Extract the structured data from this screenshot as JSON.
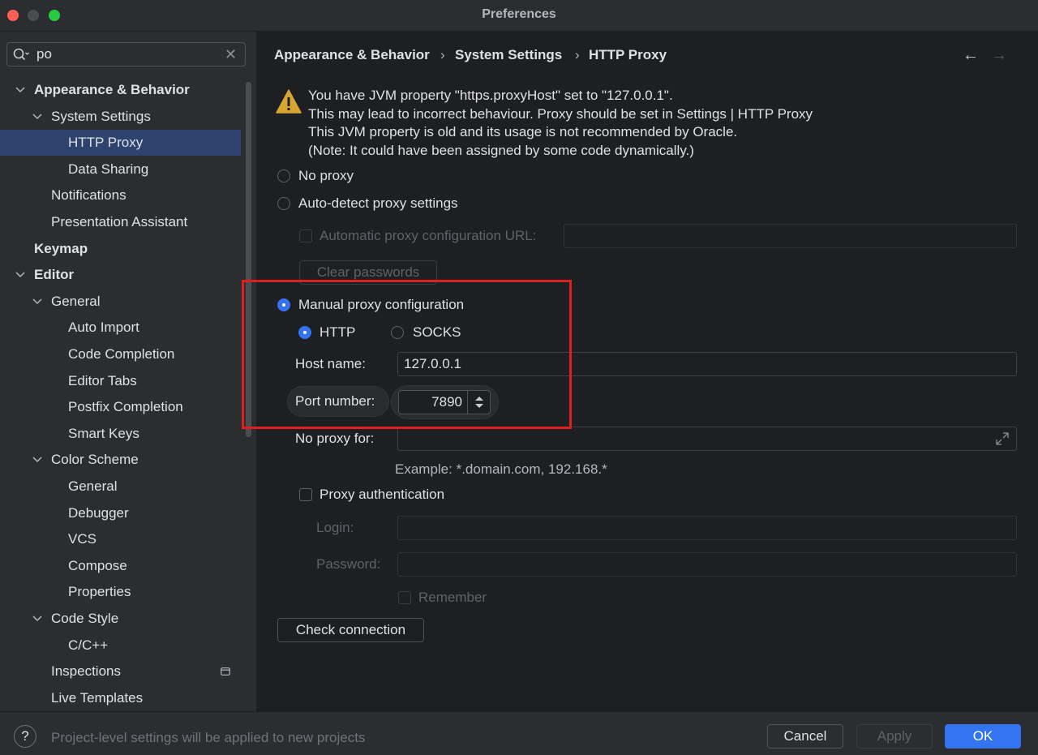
{
  "window": {
    "title": "Preferences"
  },
  "search": {
    "value": "po",
    "clear_glyph": "✕"
  },
  "sidebar": {
    "items": [
      {
        "label": "Appearance & Behavior",
        "bold": true,
        "expanded": true
      },
      {
        "label": "System Settings",
        "expanded": true
      },
      {
        "label": "HTTP Proxy",
        "selected": true
      },
      {
        "label": "Data Sharing"
      },
      {
        "label": "Notifications"
      },
      {
        "label": "Presentation Assistant"
      },
      {
        "label": "Keymap",
        "bold": true
      },
      {
        "label": "Editor",
        "bold": true,
        "expanded": true
      },
      {
        "label": "General",
        "expanded": true
      },
      {
        "label": "Auto Import"
      },
      {
        "label": "Code Completion"
      },
      {
        "label": "Editor Tabs"
      },
      {
        "label": "Postfix Completion"
      },
      {
        "label": "Smart Keys"
      },
      {
        "label": "Color Scheme",
        "expanded": true
      },
      {
        "label": "General"
      },
      {
        "label": "Debugger"
      },
      {
        "label": "VCS"
      },
      {
        "label": "Compose"
      },
      {
        "label": "Properties"
      },
      {
        "label": "Code Style",
        "expanded": true
      },
      {
        "label": "C/C++"
      },
      {
        "label": "Inspections",
        "badge": "project-scope-icon"
      },
      {
        "label": "Live Templates"
      }
    ]
  },
  "breadcrumb": {
    "items": [
      "Appearance & Behavior",
      "System Settings",
      "HTTP Proxy"
    ],
    "separator": "›",
    "back_glyph": "←",
    "forward_glyph": "→"
  },
  "warning": {
    "icon": "warning-triangle-icon",
    "lines": [
      "You have JVM property \"https.proxyHost\" set to \"127.0.0.1\".",
      "This may lead to incorrect behaviour. Proxy should be set in Settings | HTTP Proxy",
      "This JVM property is old and its usage is not recommended by Oracle.",
      "(Note: It could have been assigned by some code dynamically.)"
    ]
  },
  "proxy": {
    "no_proxy_label": "No proxy",
    "auto_detect_label": "Auto-detect proxy settings",
    "auto_config_url_label": "Automatic proxy configuration URL:",
    "auto_config_url_value": "",
    "clear_passwords_label": "Clear passwords",
    "manual_label": "Manual proxy configuration",
    "selected_mode": "manual",
    "http_label": "HTTP",
    "socks_label": "SOCKS",
    "selected_type": "HTTP",
    "host_label": "Host name:",
    "host_value": "127.0.0.1",
    "port_label": "Port number:",
    "port_value": "7890",
    "no_proxy_for_label": "No proxy for:",
    "no_proxy_for_value": "",
    "example_text": "Example: *.domain.com, 192.168.*",
    "auth_label": "Proxy authentication",
    "auth_checked": false,
    "login_label": "Login:",
    "login_value": "",
    "password_label": "Password:",
    "password_value": "",
    "remember_label": "Remember",
    "check_connection_label": "Check connection"
  },
  "footer": {
    "help_glyph": "?",
    "note": "Project-level settings will be applied to new projects",
    "cancel_label": "Cancel",
    "apply_label": "Apply",
    "ok_label": "OK"
  },
  "colors": {
    "accent": "#3574f0",
    "selection": "#2e436e",
    "warning": "#d6a633",
    "highlight_annotation": "#e21f1f"
  }
}
